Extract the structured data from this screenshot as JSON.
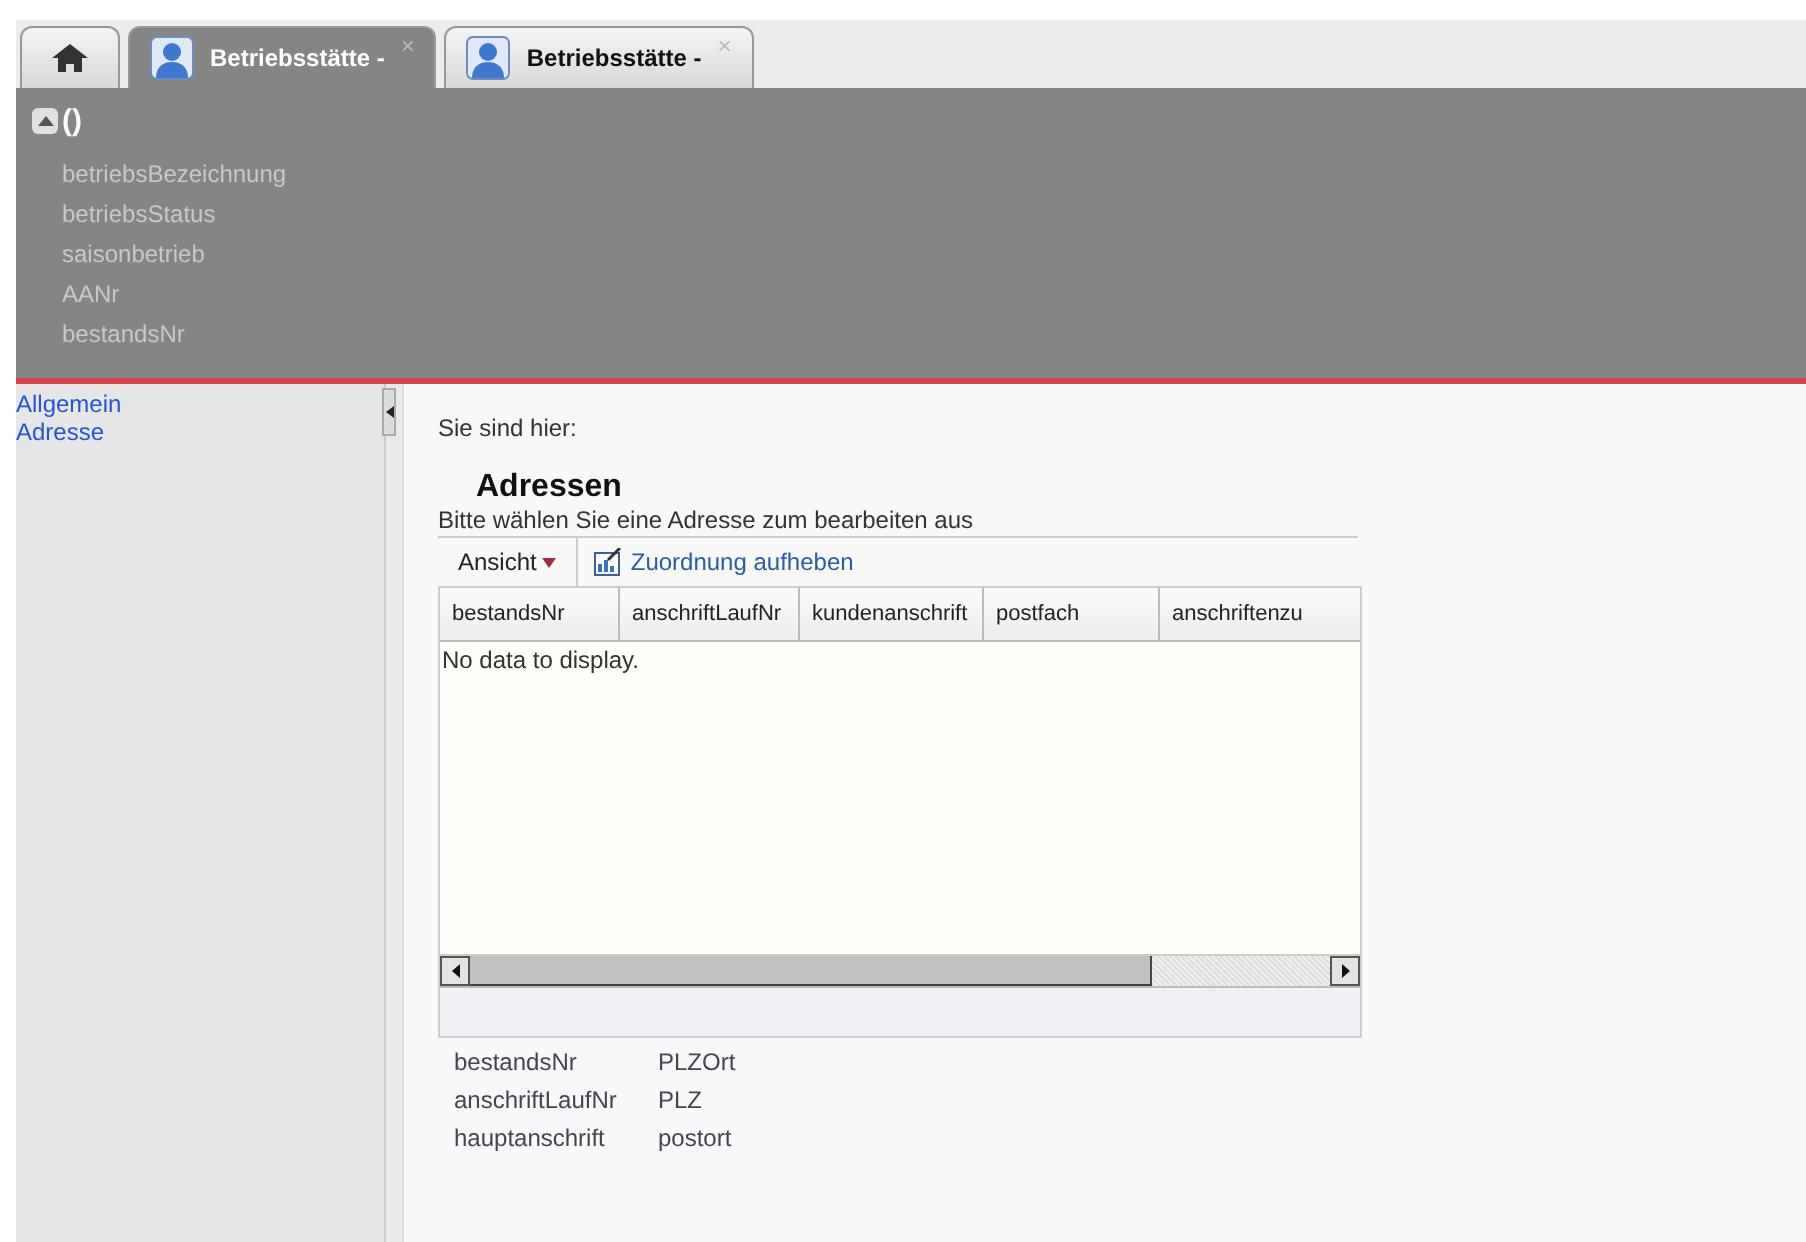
{
  "tabs": [
    {
      "kind": "home",
      "selected": false
    },
    {
      "kind": "person",
      "label": "Betriebsstätte -",
      "close": "×",
      "selected": true
    },
    {
      "kind": "person",
      "label": "Betriebsstätte -",
      "close": "×",
      "selected": false
    }
  ],
  "header": {
    "title": "()",
    "expanded": true,
    "fields": [
      "betriebsBezeichnung",
      "betriebsStatus",
      "saisonbetrieb",
      "AANr",
      "bestandsNr"
    ]
  },
  "sidebar": {
    "items": [
      "Allgemein",
      "Adresse"
    ]
  },
  "main": {
    "breadcrumb": "Sie sind hier:",
    "title": "Adressen",
    "subtitle": "Bitte wählen Sie eine Adresse zum bearbeiten aus",
    "toolbar": {
      "view": "Ansicht",
      "action": "Zuordnung aufheben"
    },
    "table": {
      "columns": [
        "bestandsNr",
        "anschriftLaufNr",
        "kundenanschrift",
        "postfach",
        "anschriftenzu"
      ],
      "empty": "No data to display."
    },
    "details": [
      [
        "bestandsNr",
        "PLZOrt"
      ],
      [
        "anschriftLaufNr",
        "PLZ"
      ],
      [
        "hauptanschrift",
        "postort"
      ]
    ]
  }
}
